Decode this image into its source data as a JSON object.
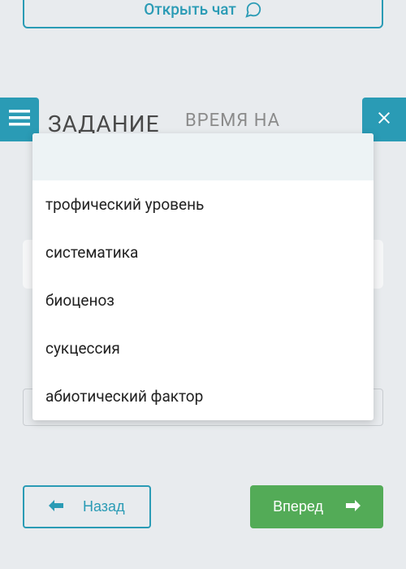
{
  "chat": {
    "label": "Открыть чат"
  },
  "bg": {
    "heading": "ЗАДАНИЕ",
    "subheading": "ВРЕМЯ НА"
  },
  "dropdown": {
    "options": [
      "трофический уровень",
      "систематика",
      "биоценоз",
      "сукцессия",
      "абиотический фактор"
    ]
  },
  "nav": {
    "back": "Назад",
    "forward": "Вперед"
  },
  "colors": {
    "teal": "#2a9bb5",
    "green": "#53ab57",
    "bg": "#e8ebee"
  }
}
